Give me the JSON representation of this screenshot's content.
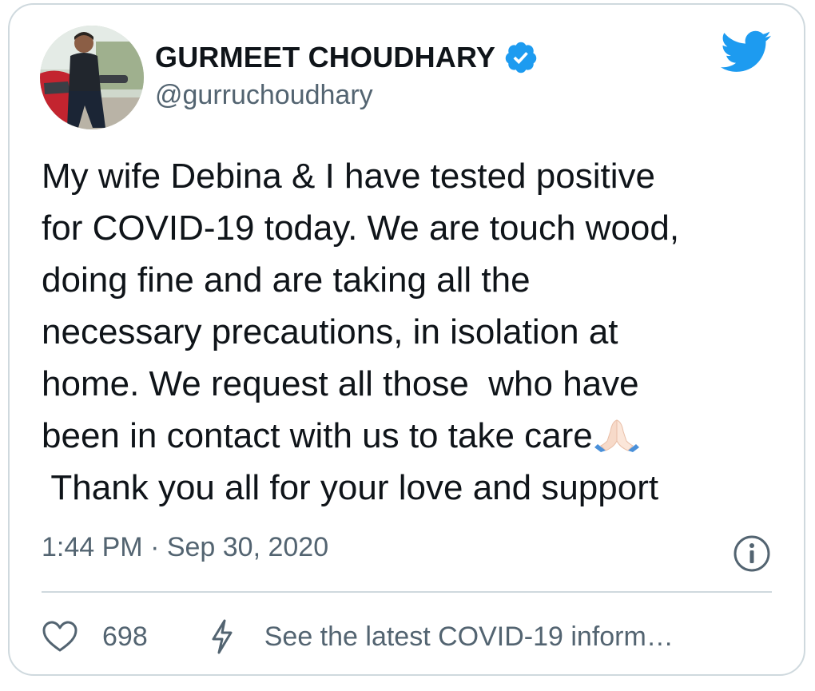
{
  "tweet": {
    "author": {
      "display_name": "GURMEET CHOUDHARY",
      "handle": "@gurruchoudhary",
      "verified": true
    },
    "text_lines": [
      "My wife Debina & I have tested positive",
      "for COVID-19 today. We are touch wood,",
      "doing fine and are taking all the",
      "necessary precautions, in isolation at",
      "home. We request all those  who have",
      "been in contact with us to take care",
      " Thank you all for your love and support"
    ],
    "emoji": "folded-hands",
    "timestamp": "1:44 PM · Sep 30, 2020",
    "like_count": "698",
    "covid_link_text": "See the latest COVID-19 inform…"
  },
  "icons": {
    "verified": "verified-badge-icon",
    "platform": "twitter-bird-icon",
    "info": "info-icon",
    "like": "heart-icon",
    "covid": "lightning-bolt-icon"
  },
  "colors": {
    "brand": "#1d9bf0",
    "text_primary": "#0f1419",
    "text_secondary": "#536471",
    "border": "#cfd9de"
  }
}
